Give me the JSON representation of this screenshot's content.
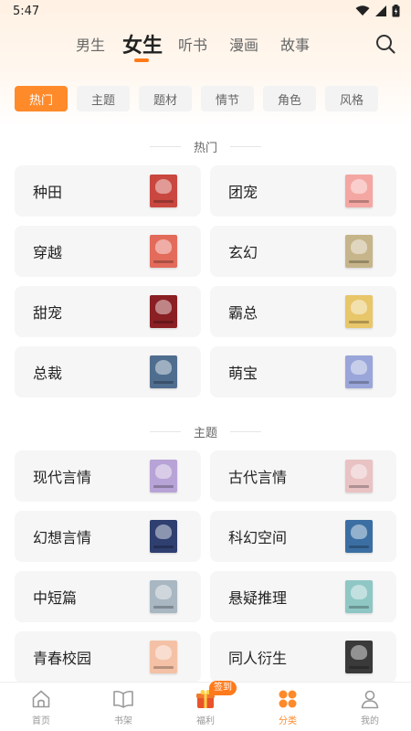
{
  "status_bar": {
    "time": "5:47"
  },
  "top_nav": {
    "tabs": [
      {
        "label": "男生"
      },
      {
        "label": "女生"
      },
      {
        "label": "听书"
      },
      {
        "label": "漫画"
      },
      {
        "label": "故事"
      }
    ],
    "active": "女生",
    "search_icon": "search-icon"
  },
  "filters": {
    "chips": [
      {
        "label": "热门"
      },
      {
        "label": "主题"
      },
      {
        "label": "题材"
      },
      {
        "label": "情节"
      },
      {
        "label": "角色"
      },
      {
        "label": "风格"
      }
    ],
    "active": "热门"
  },
  "sections": [
    {
      "title": "热门",
      "items": [
        {
          "label": "种田",
          "cover_color": "#c9473f"
        },
        {
          "label": "团宠",
          "cover_color": "#f4a7a2"
        },
        {
          "label": "穿越",
          "cover_color": "#e36b5b"
        },
        {
          "label": "玄幻",
          "cover_color": "#c6b58a"
        },
        {
          "label": "甜宠",
          "cover_color": "#8a1f24"
        },
        {
          "label": "霸总",
          "cover_color": "#e8c66a"
        },
        {
          "label": "总裁",
          "cover_color": "#4f6d8f"
        },
        {
          "label": "萌宝",
          "cover_color": "#9aa6d9"
        }
      ]
    },
    {
      "title": "主题",
      "items": [
        {
          "label": "现代言情",
          "cover_color": "#b8a3d6"
        },
        {
          "label": "古代言情",
          "cover_color": "#e9c2c4"
        },
        {
          "label": "幻想言情",
          "cover_color": "#2f3f70"
        },
        {
          "label": "科幻空间",
          "cover_color": "#3b6fa3"
        },
        {
          "label": "中短篇",
          "cover_color": "#a8b7c2"
        },
        {
          "label": "悬疑推理",
          "cover_color": "#8fc7c5"
        },
        {
          "label": "青春校园",
          "cover_color": "#f4c1a6"
        },
        {
          "label": "同人衍生",
          "cover_color": "#3a3a3a"
        }
      ]
    }
  ],
  "bottom_nav": {
    "items": [
      {
        "label": "首页",
        "icon": "home-icon"
      },
      {
        "label": "书架",
        "icon": "book-icon"
      },
      {
        "label": "福利",
        "icon": "gift-icon",
        "badge": "签到"
      },
      {
        "label": "分类",
        "icon": "category-icon"
      },
      {
        "label": "我的",
        "icon": "user-icon"
      }
    ],
    "active": "分类"
  },
  "colors": {
    "accent": "#ff8a2a",
    "card_bg": "#f6f6f6",
    "chip_bg": "#f3f3f3"
  }
}
